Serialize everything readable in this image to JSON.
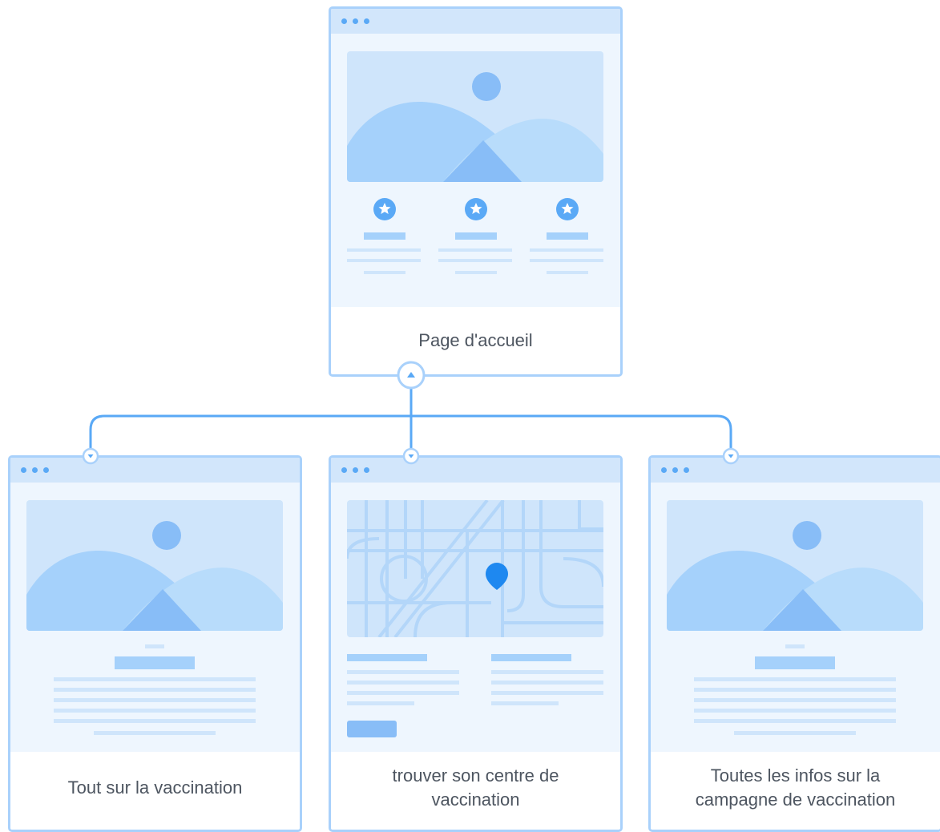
{
  "pages": {
    "home": {
      "label": "Page d'accueil"
    },
    "vaccination_info": {
      "label": "Tout sur la vaccination"
    },
    "find_center": {
      "label": "trouver son centre de vaccination"
    },
    "campaign_info": {
      "label": "Toutes les infos sur la campagne de vaccination"
    }
  },
  "colors": {
    "border": "#a9d1fb",
    "titlebar": "#d2e6fb",
    "dot": "#5aa9f6",
    "body": "#eef6fe",
    "placeholder_light": "#cfe5fb",
    "placeholder_mid": "#a5d1fb",
    "placeholder_dark": "#88bdf7",
    "connector": "#5aa9f6",
    "map_pin": "#1e88f0",
    "caption_text": "#4d5560"
  },
  "icons": {
    "expand_toggle": "chevron-up-icon",
    "child_port": "chevron-down-icon",
    "feature": "star-badge-icon",
    "location": "map-pin-icon"
  }
}
